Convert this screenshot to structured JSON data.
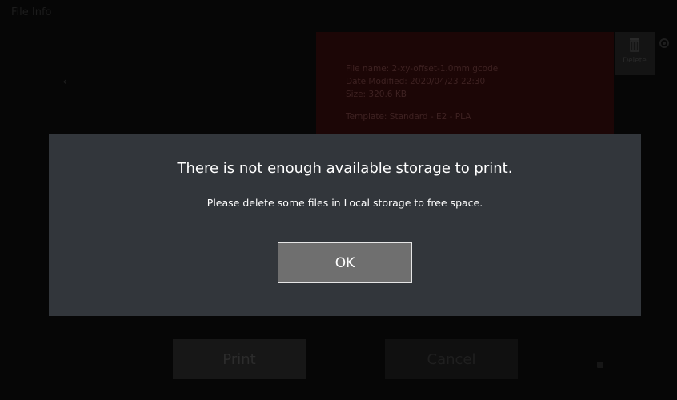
{
  "background_screen": {
    "title": "File Info",
    "back_arrow": "‹",
    "file_info": {
      "file_name": "File name: 2-xy-offset-1.0mm.gcode",
      "date_modified": "Date Modified: 2020/04/23 22:30",
      "size": "Size: 320.6 KB",
      "template": "Template: Standard - E2 - PLA"
    },
    "delete_label": "Delete",
    "print_label": "Print",
    "cancel_label": "Cancel"
  },
  "dialog": {
    "title": "There is not enough available storage to print.",
    "message": "Please delete some files in Local storage to free space.",
    "ok_label": "OK"
  },
  "colors": {
    "dialog_bg": "#32363b",
    "ok_button_bg": "#6f6f6f",
    "ok_button_border": "#e6e6e6",
    "file_panel_bg": "#1c0606",
    "screen_bg": "#060606"
  }
}
